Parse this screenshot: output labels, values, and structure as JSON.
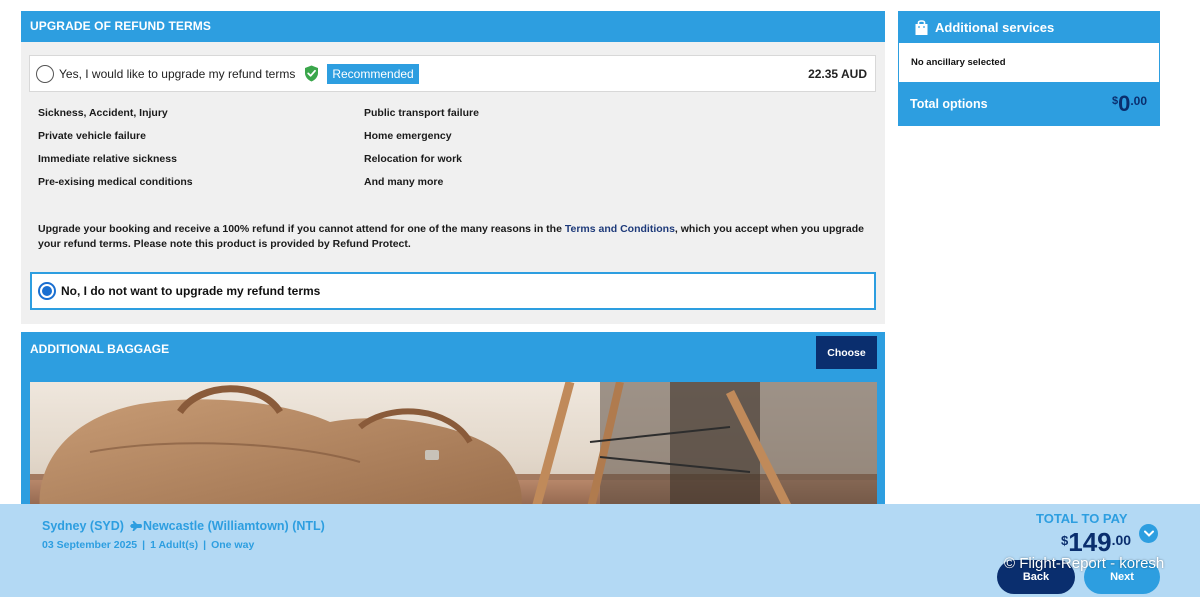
{
  "refund_section": {
    "title": "UPGRADE OF REFUND TERMS",
    "option_yes": {
      "label": "Yes, I would like to upgrade my refund terms",
      "badge": "Recommended",
      "price": "22.35 AUD",
      "selected": false
    },
    "benefits": [
      "Sickness, Accident, Injury",
      "Public transport failure",
      "Private vehicle failure",
      "Home emergency",
      "Immediate relative sickness",
      "Relocation for work",
      "Pre-exising medical conditions",
      "And many more"
    ],
    "description": {
      "before": "Upgrade your booking and receive a 100% refund if you cannot attend for one of the many reasons in the ",
      "link": "Terms and Conditions",
      "after": ", which you accept when you upgrade your refund terms. Please note this product is provided by Refund Protect."
    },
    "option_no": {
      "label": "No, I do not want to upgrade my refund terms",
      "selected": true
    }
  },
  "baggage_section": {
    "title": "ADDITIONAL BAGGAGE",
    "choose_label": "Choose"
  },
  "sidebar": {
    "title": "Additional services",
    "empty_text": "No ancillary selected",
    "total_label": "Total options",
    "total": {
      "currency": "$",
      "whole": "0",
      "cents": ".00"
    }
  },
  "bottom_bar": {
    "origin": "Sydney (SYD)",
    "destination": "Newcastle (Williamtown) (NTL)",
    "date": "03 September 2025",
    "passengers": "1 Adult(s)",
    "trip_type": "One way",
    "total_label": "TOTAL TO PAY",
    "total": {
      "currency": "$",
      "whole": "149",
      "cents": ".00"
    },
    "back_label": "Back",
    "next_label": "Next",
    "watermark": "© Flight-Report - koresh"
  },
  "colors": {
    "brand_blue": "#2d9ee0",
    "navy": "#0a2e6e",
    "panel_gray": "#f0f0f0",
    "bottom_bar": "#b3d9f4",
    "shield_green": "#3aa64b"
  },
  "icons": [
    "shield-check-icon",
    "shopping-bag-icon",
    "plane-icon",
    "chevron-down-icon"
  ]
}
